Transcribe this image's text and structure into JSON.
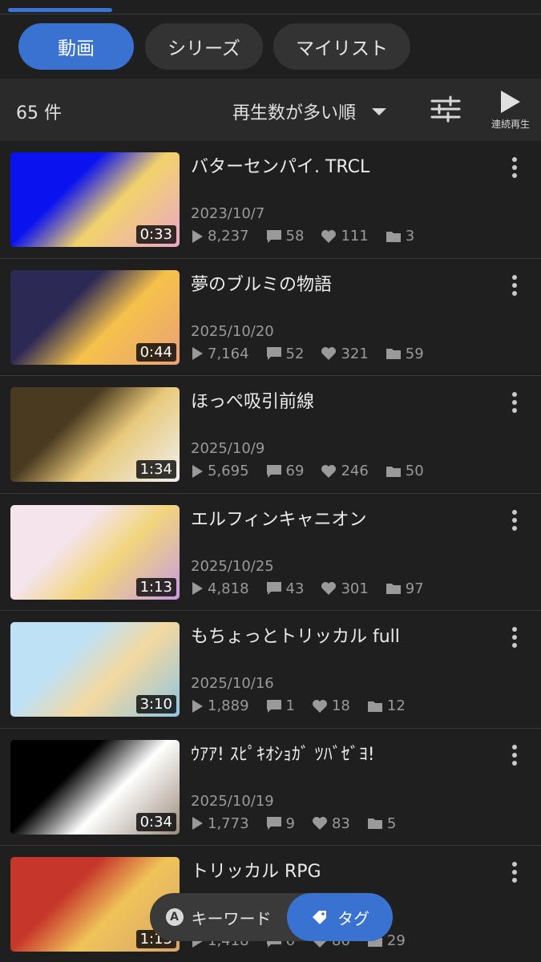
{
  "tabs": [
    {
      "label": "動画",
      "active": true
    },
    {
      "label": "シリーズ",
      "active": false
    },
    {
      "label": "マイリスト",
      "active": false
    }
  ],
  "toolbar": {
    "count": "65 件",
    "sort_label": "再生数が多い順",
    "filter_icon": "sliders-icon",
    "continuous_label": "連続再生"
  },
  "videos": [
    {
      "title": "バターセンパイ. TRCL",
      "date": "2023/10/7",
      "duration": "0:33",
      "views": "8,237",
      "comments": "58",
      "likes": "111",
      "mylists": "3",
      "thumb_colors": [
        "#0a12f0",
        "#f3d36b",
        "#e9a6c9"
      ]
    },
    {
      "title": "夢のブルミの物語",
      "date": "2025/10/20",
      "duration": "0:44",
      "views": "7,164",
      "comments": "52",
      "likes": "321",
      "mylists": "59",
      "thumb_colors": [
        "#2c2a55",
        "#f6c24a",
        "#e8a07a"
      ]
    },
    {
      "title": "ほっぺ吸引前線",
      "date": "2025/10/9",
      "duration": "1:34",
      "views": "5,695",
      "comments": "69",
      "likes": "246",
      "mylists": "50",
      "thumb_colors": [
        "#4a3a20",
        "#e8c97a",
        "#f0f0f0"
      ]
    },
    {
      "title": "エルフィンキャニオン",
      "date": "2025/10/25",
      "duration": "1:13",
      "views": "4,818",
      "comments": "43",
      "likes": "301",
      "mylists": "97",
      "thumb_colors": [
        "#f5e4ec",
        "#f2d67c",
        "#c79ae0"
      ]
    },
    {
      "title": "もちょっとトリッカル full",
      "date": "2025/10/16",
      "duration": "3:10",
      "views": "1,889",
      "comments": "1",
      "likes": "18",
      "mylists": "12",
      "thumb_colors": [
        "#bfe1f5",
        "#f4d9a0",
        "#8fc4e0"
      ]
    },
    {
      "title": "ｳｱｱ! ｽﾋﾟｷｵｼｮｶﾞ ﾂﾊﾞｾﾞﾖ!",
      "date": "2025/10/19",
      "duration": "0:34",
      "views": "1,773",
      "comments": "9",
      "likes": "83",
      "mylists": "5",
      "thumb_colors": [
        "#000000",
        "#ffffff",
        "#9a8a7a"
      ]
    },
    {
      "title": "トリッカル RPG",
      "date": "",
      "duration": "1:13",
      "views": "1,418",
      "comments": "6",
      "likes": "86",
      "mylists": "29",
      "thumb_colors": [
        "#c6362a",
        "#f0c45a",
        "#d9a36b"
      ]
    }
  ],
  "bottom_toggle": {
    "keyword_label": "キーワード",
    "tag_label": "タグ",
    "active": "tag"
  },
  "colors": {
    "accent": "#3a72d1",
    "background": "#1f1f1f",
    "toolbar": "#2a2a2a"
  }
}
